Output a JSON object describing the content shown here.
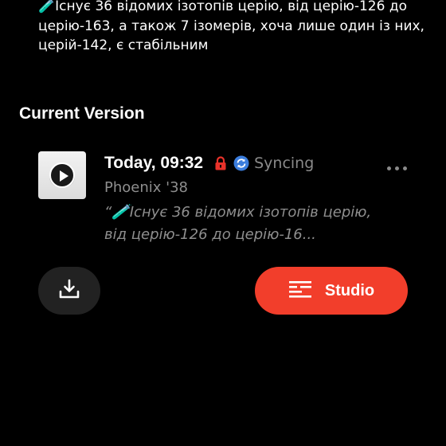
{
  "description": {
    "emoji": "🧪",
    "text": "Існує 36 відомих ізотопів церію, від церію-126 до церію-163, а також 7 ізомерів, хоча лише один із них, церій-142, є стабільним"
  },
  "section_title": "Current Version",
  "version": {
    "time": "Today, 09:32",
    "status_text": "Syncing",
    "voice_name": "Phoenix '38",
    "quote_prefix": "“",
    "quote_emoji": "🧪",
    "quote_text": "Існує 36 відомих ізотопів церію, від церію-126 до церію-16..."
  },
  "buttons": {
    "studio_label": "Studio"
  },
  "colors": {
    "accent": "#f23e2b",
    "background": "#000000",
    "muted_text": "#8e8e8e",
    "lock": "#e8322a",
    "sync": "#3b7ddd"
  },
  "icons": {
    "thumb": "play-icon",
    "lock": "lock-icon",
    "sync": "sync-icon",
    "more": "more-icon",
    "download": "download-icon",
    "studio": "studio-list-icon"
  }
}
